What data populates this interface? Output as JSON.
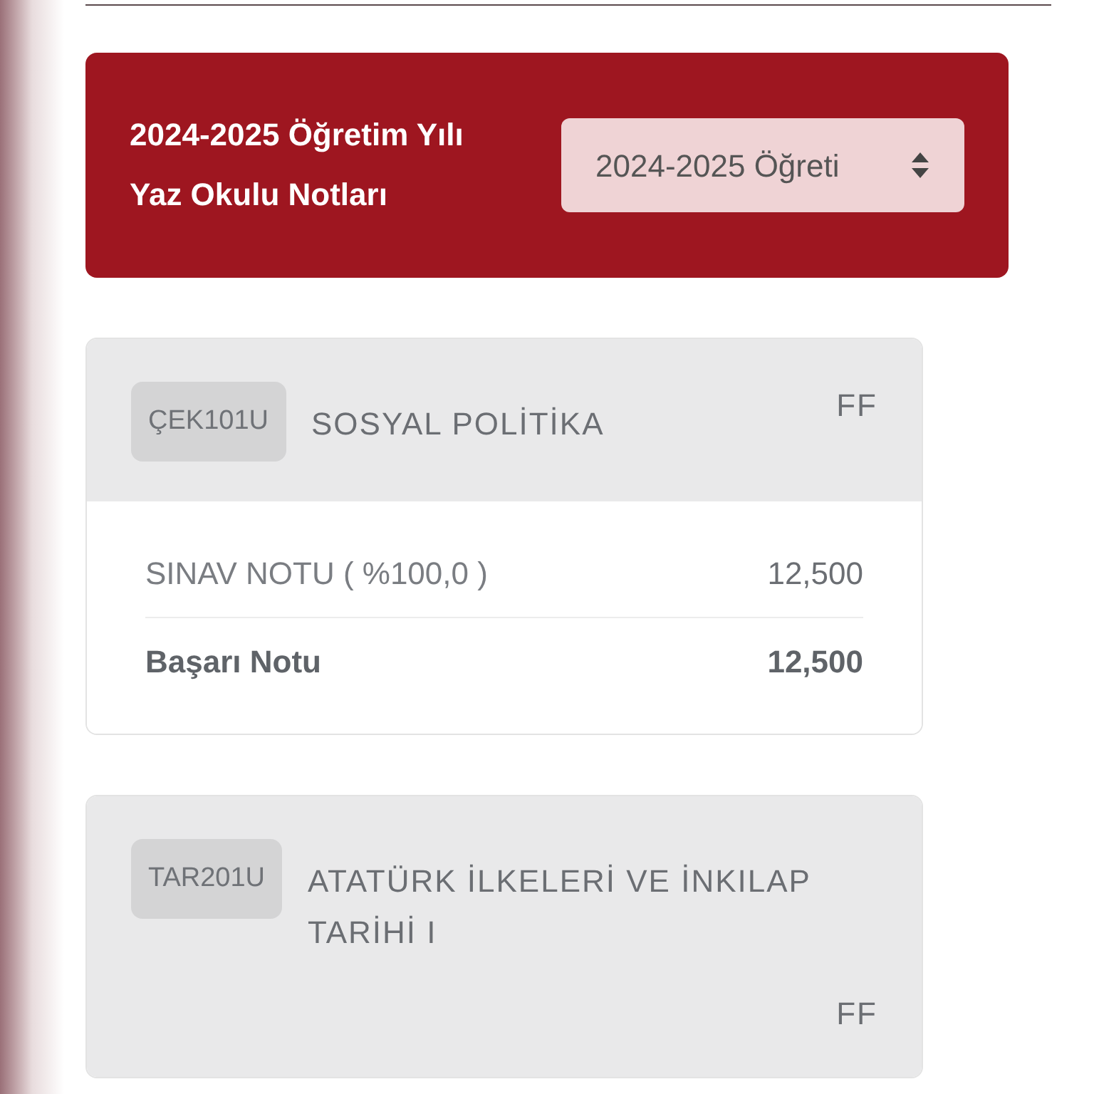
{
  "header": {
    "title": "2024-2025 Öğretim Yılı Yaz Okulu Notları",
    "select": {
      "value": "2024-2025 Öğreti"
    }
  },
  "courses": [
    {
      "code": "ÇEK101U",
      "name": "SOSYAL POLİTİKA",
      "grade": "FF",
      "rows": [
        {
          "label": "SINAV NOTU ( %100,0 )",
          "value": "12,500",
          "kind": "exam"
        },
        {
          "label": "Başarı Notu",
          "value": "12,500",
          "kind": "total"
        }
      ]
    },
    {
      "code": "TAR201U",
      "name": "ATATÜRK İLKELERİ VE İNKILAP TARİHİ I",
      "grade": "FF"
    }
  ]
}
